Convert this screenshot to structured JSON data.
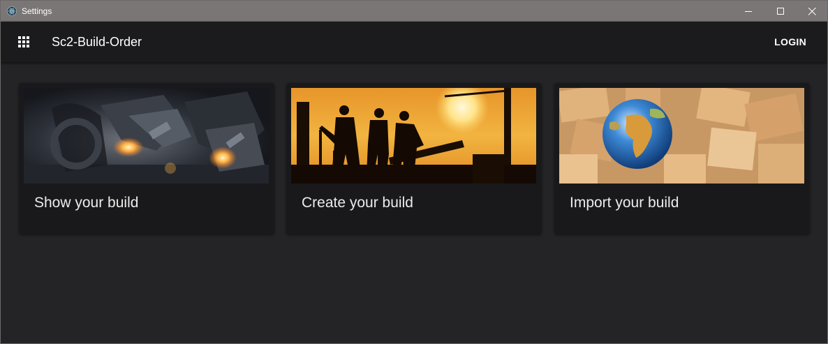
{
  "window": {
    "title": "Settings"
  },
  "appbar": {
    "title": "Sc2-Build-Order",
    "login_label": "LOGIN"
  },
  "icons": {
    "app": "electron-atom-icon",
    "menu": "apps-grid-icon",
    "minimize": "minimize-icon",
    "maximize": "maximize-icon",
    "close": "close-icon"
  },
  "colors": {
    "background": "#242427",
    "appbar": "#1b1b1d",
    "card": "#19191b",
    "titlebar": "#7a7675"
  },
  "cards": [
    {
      "title": "Show your build",
      "image": "mechs firing in dark factory"
    },
    {
      "title": "Create your build",
      "image": "construction workers silhouette at sunset"
    },
    {
      "title": "Import your build",
      "image": "globe among cardboard boxes"
    }
  ]
}
